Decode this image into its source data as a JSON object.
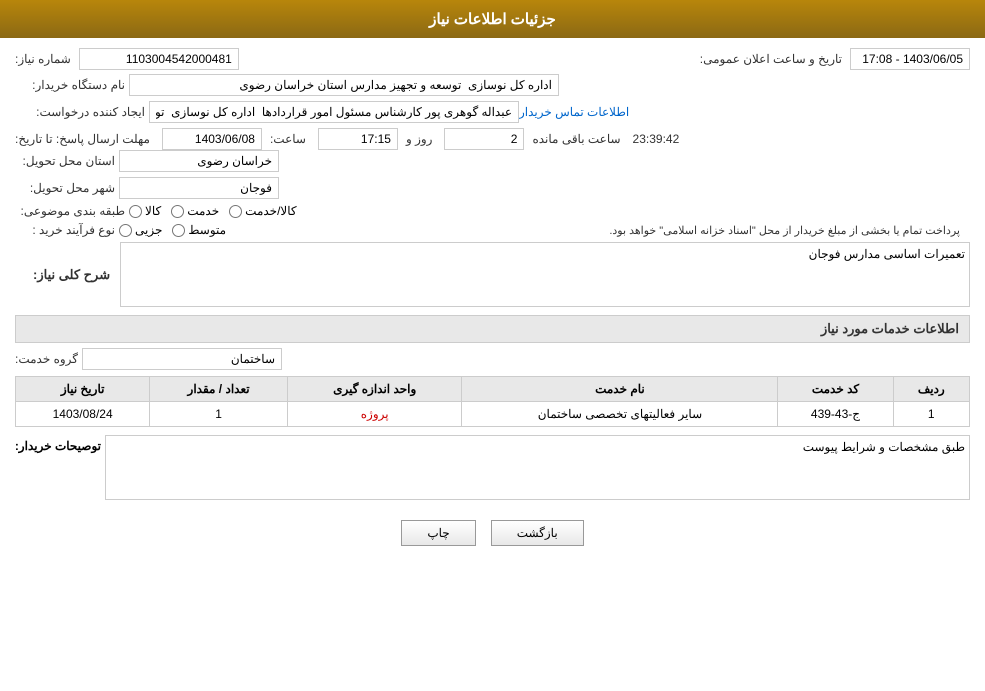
{
  "header": {
    "title": "جزئیات اطلاعات نیاز"
  },
  "fields": {
    "shomara_niaz_label": "شماره نیاز:",
    "shomara_niaz_value": "1103004542000481",
    "nam_dastgah_label": "نام دستگاه خریدار:",
    "nam_dastgah_value": "اداره کل نوسازی  توسعه و تجهیز مدارس استان خراسان رضوی",
    "ijad_label": "ایجاد کننده درخواست:",
    "ijad_value": "عبداله گوهری پور کارشناس مسئول امور قراردادها  اداره کل نوسازی  توسعه و ز",
    "mohlat_label": "مهلت ارسال پاسخ: تا تاریخ:",
    "mohlat_date": "1403/06/08",
    "mohlat_time_label": "ساعت:",
    "mohlat_time": "17:15",
    "mohlat_roz_label": "روز و",
    "mohlat_roz": "2",
    "mohlat_remaining_label": "ساعت باقی مانده",
    "mohlat_remaining": "23:39:42",
    "ostan_label": "استان محل تحویل:",
    "ostan_value": "خراسان رضوی",
    "shahr_label": "شهر محل تحویل:",
    "shahr_value": "فوجان",
    "tabaqe_label": "طبقه بندی موضوعی:",
    "kala_label": "کالا",
    "khedmat_label": "خدمت",
    "kala_khedmat_label": "کالا/خدمت",
    "nooe_farayand_label": "نوع فرآیند خرید :",
    "jozii_label": "جزیی",
    "motavaset_label": "متوسط",
    "farayand_desc": "پرداخت تمام یا بخشی از مبلغ خریدار از محل \"اسناد خزانه اسلامی\" خواهد بود.",
    "tarikh_aalan_label": "تاریخ و ساعت اعلان عمومی:",
    "tarikh_aalan_value": "1403/06/05 - 17:08",
    "ettelaat_tamas_label": "اطلاعات تماس خریدار"
  },
  "sharh_niaz": {
    "section_title": "شرح کلی نیاز:",
    "value": "تعمیرات اساسی مدارس فوجان"
  },
  "khadamat": {
    "section_title": "اطلاعات خدمات مورد نیاز",
    "goroh_label": "گروه خدمت:",
    "goroh_value": "ساختمان",
    "table": {
      "headers": [
        "ردیف",
        "کد خدمت",
        "نام خدمت",
        "واحد اندازه گیری",
        "تعداد / مقدار",
        "تاریخ نیاز"
      ],
      "rows": [
        {
          "radif": "1",
          "kod_khedmat": "ج-43-439",
          "nam_khedmat": "سایر فعالیتهای تخصصی ساختمان",
          "vahed": "پروژه",
          "tedad": "1",
          "tarikh": "1403/08/24"
        }
      ]
    }
  },
  "tosiyat": {
    "label": "توصیحات خریدار:",
    "value": "طبق مشخصات و شرایط پیوست"
  },
  "buttons": {
    "chap": "چاپ",
    "bazgasht": "بازگشت"
  }
}
